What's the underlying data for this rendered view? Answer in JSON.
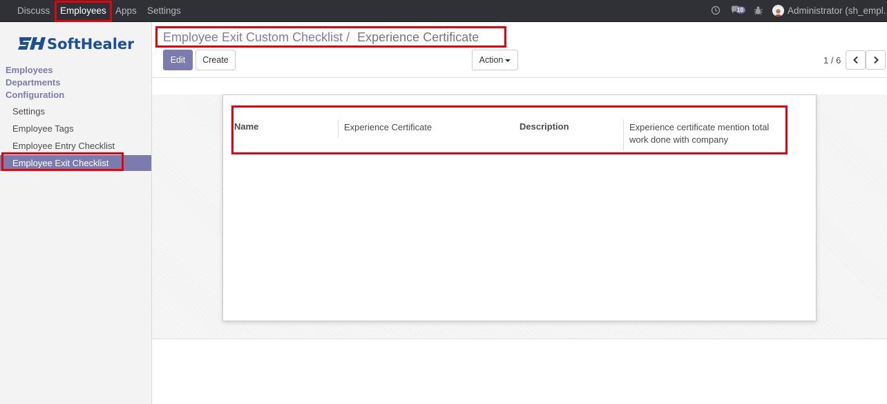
{
  "navbar": {
    "menus": [
      "Discuss",
      "Employees",
      "Apps",
      "Settings"
    ],
    "chat_count": "10",
    "user_name": "Administrator (sh_empl..."
  },
  "sidebar": {
    "logo": "SoftHealer",
    "sections": [
      "Employees",
      "Departments",
      "Configuration"
    ],
    "items": [
      "Settings",
      "Employee Tags",
      "Employee Entry Checklist",
      "Employee Exit Checklist"
    ]
  },
  "breadcrumb": {
    "parent": "Employee Exit Custom Checklist",
    "separator": "/",
    "current": "Experience Certificate"
  },
  "buttons": {
    "edit": "Edit",
    "create": "Create",
    "action": "Action"
  },
  "pager": {
    "text": "1 / 6"
  },
  "form": {
    "name_label": "Name",
    "name_value": "Experience Certificate",
    "description_label": "Description",
    "description_value": "Experience certificate mention total work done with company"
  },
  "colors": {
    "accent": "#7c7bad",
    "navbar": "#2f3136",
    "highlight": "#e8000a"
  }
}
